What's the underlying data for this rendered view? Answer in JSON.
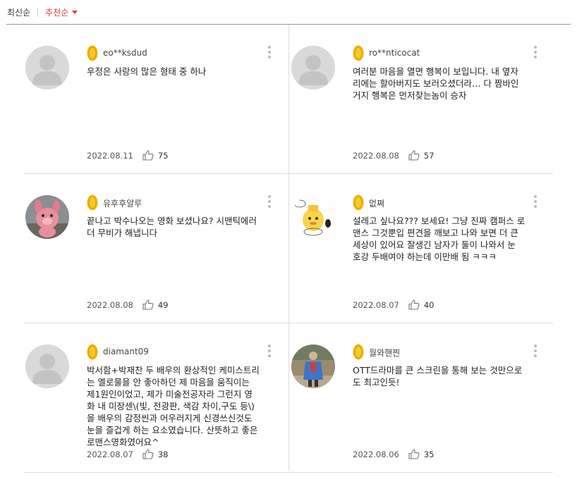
{
  "sort": {
    "latest": "최신순",
    "recommended": "추천순"
  },
  "colors": {
    "accent": "#e8382f",
    "coin": "#f2b600"
  },
  "comments": [
    {
      "nick": "eo**ksdud",
      "text": "우정은 사랑의 많은 형태 중 하나",
      "date": "2022.08.11",
      "likes": "75",
      "avatar": "default"
    },
    {
      "nick": "ro**nticocat",
      "text": "여러분 마음을 열면 행복이 보입니다. 내 옆자리에는 할아버지도 보러오셨더라… 다 짬바인거지 행복은 먼저찾는놈이 승자",
      "date": "2022.08.08",
      "likes": "57",
      "avatar": "default"
    },
    {
      "nick": "유후후얄루",
      "text": "끝나고 박수나오는 영화 보셨나요? 시맨틱에러 더 무비가 해냅니다",
      "date": "2022.08.08",
      "likes": "49",
      "avatar": "pink-plush"
    },
    {
      "nick": "없쪄",
      "text": "설레고 싶나요??? 보세요! 그냥 진짜 캠퍼스 로맨스 그것뿐입 편견을 깨보고 나와 보면 더 큰 세상이 있어요 잘생긴 남자가 둘이 나와서 눈 호강 두배여야 하는데 이만배 됨 ㅋㅋㅋ",
      "date": "2022.08.07",
      "likes": "40",
      "avatar": "cartoon"
    },
    {
      "nick": "diamant09",
      "text": "박서함+박재찬 두 배우의 환상적인 케미스트리는 멜로물을 안 좋아하던 제 마음을 움직이는 제1원인이었고, 제가 미술전공자라 그런지 영화 내 미장센\\(빛, 전광판, 색감 차이,구도 등\\)을 배우의 감정씬과 어우러지게 신경쓰신것도 눈을 즐겁게 하는 요소였습니다. 산뜻하고 좋은 로맨스영화였어요^",
      "date": "2022.08.07",
      "likes": "38",
      "avatar": "default"
    },
    {
      "nick": "월와핸찐",
      "text": "OTT드라마를 큰 스크린을 통해 보는 것만으로도 최고인듯!",
      "date": "2022.08.06",
      "likes": "35",
      "avatar": "costume-photo"
    }
  ]
}
